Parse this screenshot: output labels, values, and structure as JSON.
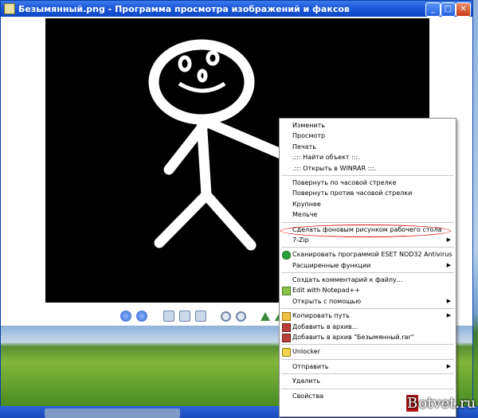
{
  "window": {
    "title": "Безымянный.png - Программа просмотра изображений и факсов",
    "buttons": {
      "minimize": "_",
      "maximize": "□",
      "close": "✕"
    }
  },
  "toolbar": {
    "icons": [
      "prev-icon",
      "next-icon",
      "best-fit-icon",
      "actual-size-icon",
      "slideshow-icon",
      "zoom-in-icon",
      "zoom-out-icon",
      "rotate-cw-icon",
      "rotate-ccw-icon"
    ]
  },
  "context_menu": {
    "items": [
      {
        "label": "Изменить"
      },
      {
        "label": "Просмотр"
      },
      {
        "label": "Печать"
      },
      {
        "label": ".::: Найти объект :::."
      },
      {
        "label": ".::: Открыть в WINRAR :::."
      },
      {
        "label": "Повернуть по часовой стрелке"
      },
      {
        "label": "Повернуть против часовой стрелки"
      },
      {
        "label": "Крупнее"
      },
      {
        "label": "Мельче"
      },
      {
        "label": "Сделать фоновым рисунком рабочего стола"
      },
      {
        "label": "7-Zip"
      },
      {
        "label": "Сканировать программой ESET NOD32 Antivirus"
      },
      {
        "label": "Расширенные функции"
      },
      {
        "label": "Создать комментарий к файлу..."
      },
      {
        "label": "Edit with Notepad++"
      },
      {
        "label": "Открыть с помощью"
      },
      {
        "label": "Копировать путь"
      },
      {
        "label": "Добавить в архив..."
      },
      {
        "label": "Добавить в архив \"Безымянный.rar\""
      },
      {
        "label": "Unlocker"
      },
      {
        "label": "Отправить"
      },
      {
        "label": "Удалить"
      },
      {
        "label": "Свойства"
      }
    ],
    "submenu_arrow": "▶"
  },
  "watermark": {
    "first": "B",
    "rest": "otvet.ru"
  },
  "colors": {
    "highlight_ring": "#e01010",
    "title_bar": "#1b58d8"
  }
}
